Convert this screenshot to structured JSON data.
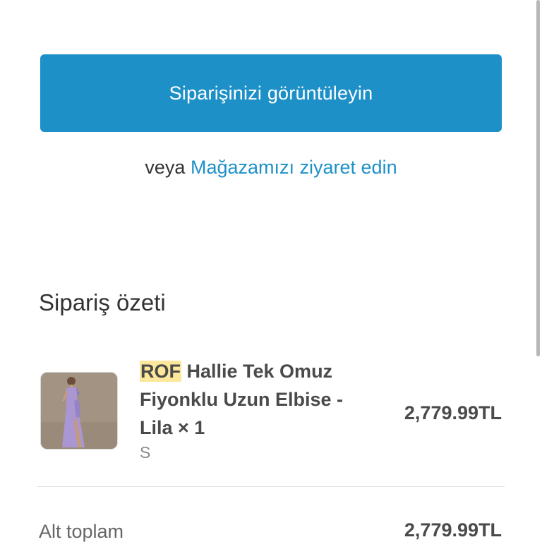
{
  "actions": {
    "view_order_label": "Siparişinizi görüntüleyin",
    "or_text": "veya",
    "visit_store_link": "Mağazamızı ziyaret edin"
  },
  "order_summary": {
    "title": "Sipariş özeti",
    "items": [
      {
        "brand": "ROF",
        "name": " Hallie Tek Omuz Fiyonklu Uzun Elbise - Lila × 1",
        "variant": "S",
        "price": "2,779.99TL",
        "image": "purple-one-shoulder-dress-photo"
      }
    ],
    "subtotal_label": "Alt toplam",
    "subtotal_value": "2,779.99TL"
  },
  "colors": {
    "accent": "#1e90c8",
    "highlight": "#fce79a",
    "text": "#333333"
  }
}
